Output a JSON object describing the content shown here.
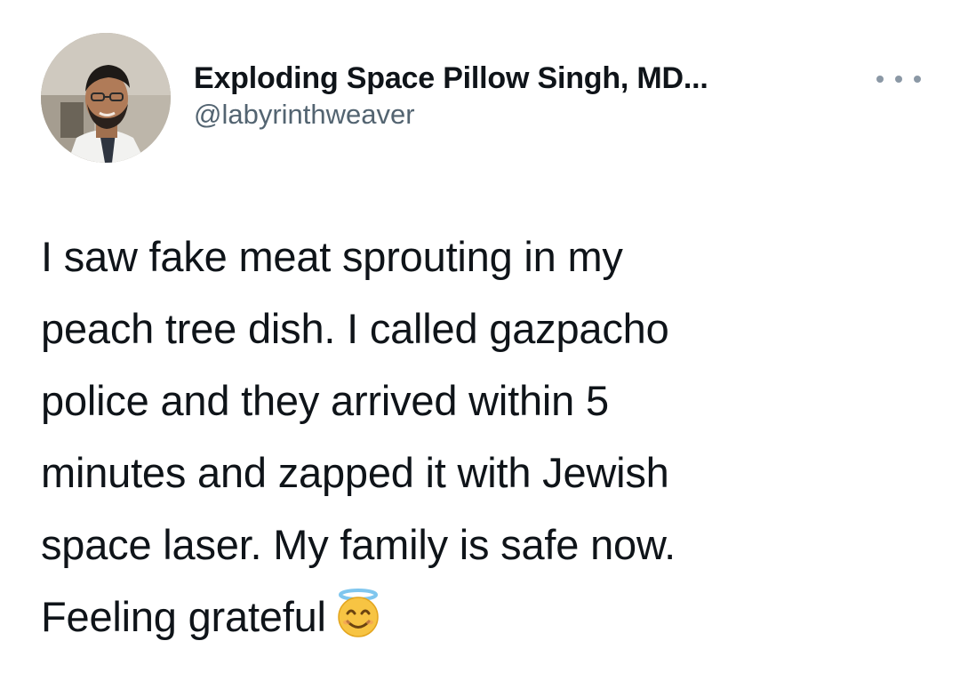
{
  "tweet": {
    "author": {
      "display_name": "Exploding Space Pillow Singh, MD...",
      "handle": "@labyrinthweaver",
      "avatar": "profile-photo"
    },
    "more_icon": "more-options-icon",
    "text_lines": [
      "I saw fake meat sprouting in my",
      "peach tree dish. I called gazpacho",
      "police and they arrived within 5",
      "minutes and zapped it with Jewish",
      "space laser. My family is safe now.",
      "Feeling grateful"
    ],
    "emoji": "smiling-face-with-halo-emoji"
  },
  "colors": {
    "primary_text": "#0f1419",
    "secondary_text": "#536471",
    "icon_gray": "#8b98a5",
    "background": "#ffffff"
  }
}
